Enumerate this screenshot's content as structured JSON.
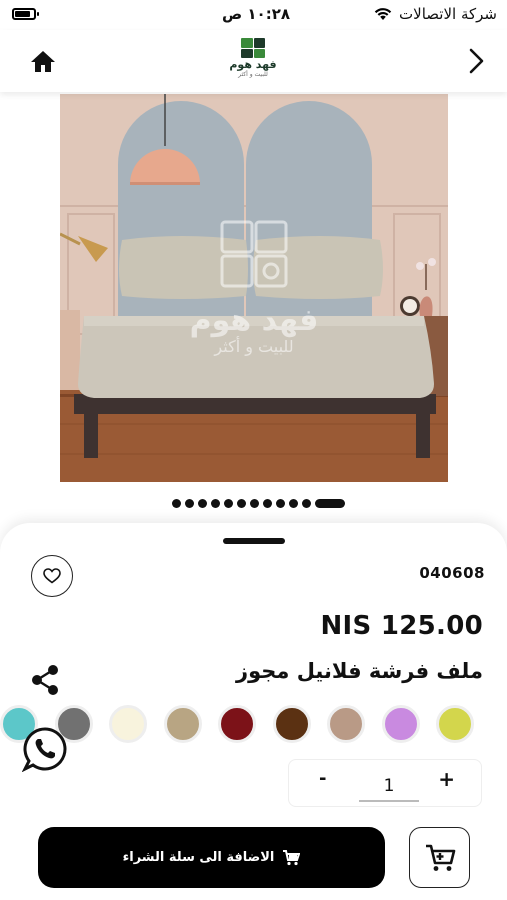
{
  "status_bar": {
    "carrier": "شركة الاتصالات",
    "time": "١٠:٢٨ ص",
    "battery_level": 0.85
  },
  "header": {
    "logo_name": "فهد هوم",
    "logo_tagline": "للبيت و أكثر",
    "home_icon": "home-icon",
    "back_icon": "chevron-right-icon"
  },
  "gallery": {
    "image_count": 12,
    "active_index": 11,
    "watermark_name": "فهد هوم",
    "watermark_tagline": "للبيت و أكثر"
  },
  "product": {
    "sku": "040608",
    "price": "NIS 125.00",
    "name": "ملف فرشة فلانيل مجوز",
    "colors": [
      "#d3d64c",
      "#c98ae0",
      "#b99a86",
      "#5b3112",
      "#7c1218",
      "#b8a583",
      "#f8f3dd",
      "#717171",
      "#5cc7c9"
    ]
  },
  "quantity": {
    "minus_label": "-",
    "plus_label": "+",
    "value": "1"
  },
  "actions": {
    "add_to_cart_label": "الاضافة الى سلة الشراء",
    "favorite_icon": "heart-icon",
    "share_icon": "share-icon",
    "whatsapp_icon": "whatsapp-icon",
    "cart_icon": "cart-icon"
  }
}
